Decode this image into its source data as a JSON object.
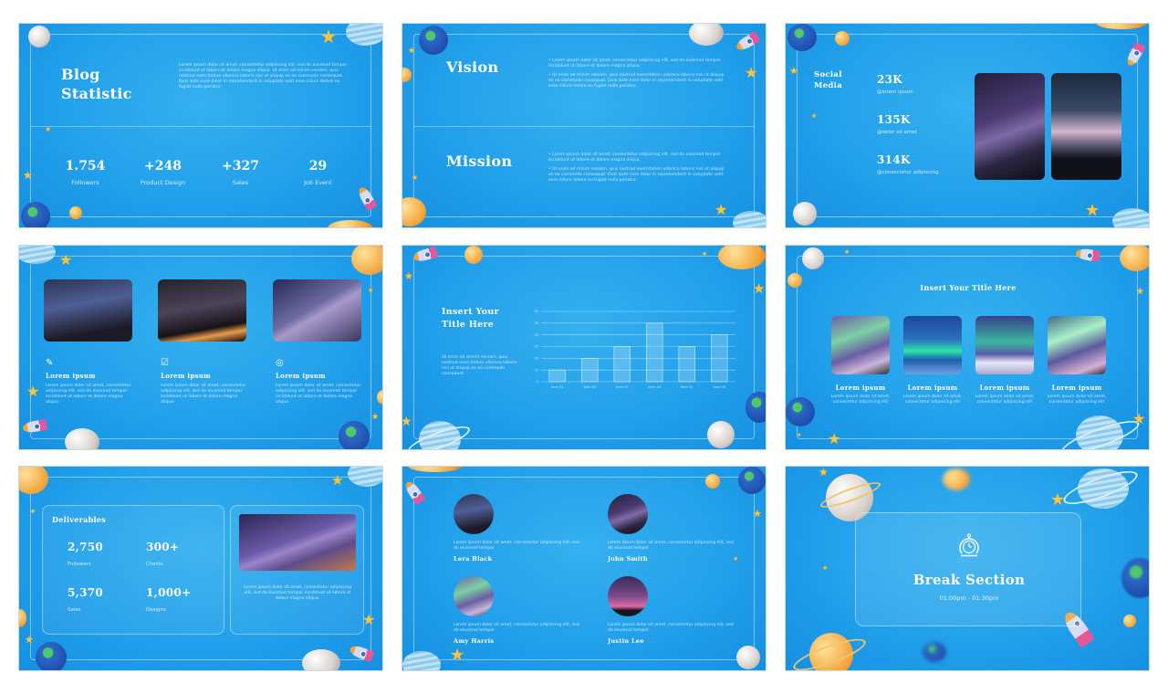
{
  "slides": [
    {
      "title": "Blog Statistic",
      "title_lines": [
        "Blog",
        "Statistic"
      ],
      "paragraph": "Lorem ipsum dolor sit amet, consectetur adipiscing elit, sed do eiusmod tempor incididunt ut labore et dolore magna aliqua. Ut enim ad minim veniam, quis nostrud exercitation ullamco laboris nisi ut aliquip ex ea commodo consequat. Duis aute irure dolor in reprehenderit in voluptate velit esse cillum dolore eu fugiat nulla pariatur.",
      "stats": [
        {
          "value": "1.754",
          "label": "Followers"
        },
        {
          "value": "+248",
          "label": "Product Design"
        },
        {
          "value": "+327",
          "label": "Sales"
        },
        {
          "value": "29",
          "label": "Job Event"
        }
      ]
    },
    {
      "sections": [
        {
          "title": "Vision",
          "bullets": [
            "Lorem ipsum dolor sit amet, consectetur adipiscing elit, sed do eiusmod tempor incididunt ut labore et dolore magna aliqua.",
            "Ut enim ad minim veniam, quis nostrud exercitation ullamco laboris nisi ut aliquip ex ea commodo consequat. Duis aute irure dolor in reprehenderit in voluptate velit esse cillum dolore eu fugiat nulla pariatur."
          ]
        },
        {
          "title": "Mission",
          "bullets": [
            "Lorem ipsum dolor sit amet, consectetur adipiscing elit, sed do eiusmod tempor incididunt ut labore et dolore magna aliqua.",
            "Ut enim ad minim veniam, quis nostrud exercitation ullamco laboris nisi ut aliquip ex ea commodo consequat. Duis aute irure dolor in reprehenderit in voluptate velit esse cillum dolore eu fugiat nulla pariatur."
          ]
        }
      ]
    },
    {
      "title_lines": [
        "Social",
        "Media"
      ],
      "stats": [
        {
          "value": "23K",
          "handle": "@lorem ipsum"
        },
        {
          "value": "135K",
          "handle": "@dolor sit amet"
        },
        {
          "value": "314K",
          "handle": "@consectetur adipiscing"
        }
      ]
    },
    {
      "columns": [
        {
          "icon": "document-edit-icon",
          "title": "Lorem ipsum",
          "text": "Lorem ipsum dolor sit amet, consectetur adipiscing elit, sed do eiusmod tempor incididunt ut labore et dolore magna aliqua."
        },
        {
          "icon": "checklist-icon",
          "title": "Lorem ipsum",
          "text": "Lorem ipsum dolor sit amet, consectetur adipiscing elit, sed do eiusmod tempor incididunt ut labore et dolore magna aliqua."
        },
        {
          "icon": "target-icon",
          "title": "Lorem ipsum",
          "text": "Lorem ipsum dolor sit amet, consectetur adipiscing elit, sed do eiusmod tempor incididunt ut labore et dolore magna aliqua."
        }
      ]
    },
    {
      "title_lines": [
        "Insert Your",
        "Title Here"
      ],
      "paragraph": "Ut enim ad minim veniam, quis nostrud exercitation ullamco laboris nisi ut aliquip ex ea commodo consequat."
    },
    {
      "title": "Insert Your Title Here",
      "cards": [
        {
          "title": "Lorem ipsum",
          "text": "Lorem ipsum dolor sit amet, consectetur adipiscing elit"
        },
        {
          "title": "Lorem ipsum",
          "text": "Lorem ipsum dolor sit amet, consectetur adipiscing elit"
        },
        {
          "title": "Lorem ipsum",
          "text": "Lorem ipsum dolor sit amet, consectetur adipiscing elit"
        },
        {
          "title": "Lorem ipsum",
          "text": "Lorem ipsum dolor sit amet, consectetur adipiscing elit"
        }
      ]
    },
    {
      "title": "Deliverables",
      "stats": [
        {
          "value": "2,750",
          "label": "Followers"
        },
        {
          "value": "300+",
          "label": "Clients"
        },
        {
          "value": "5,370",
          "label": "Sales"
        },
        {
          "value": "1,000+",
          "label": "Designs"
        }
      ],
      "caption": "Lorem ipsum dolor sit amet, consectetur adipiscing elit, sed do eiusmod tempor incididunt ut labore et dolore magna aliqua."
    },
    {
      "team": [
        {
          "name": "Lora Black",
          "text": "Lorem ipsum dolor sit amet, consectetur adipiscing elit, sed do eiusmod tempor"
        },
        {
          "name": "John Smith",
          "text": "Lorem ipsum dolor sit amet, consectetur adipiscing elit, sed do eiusmod tempor"
        },
        {
          "name": "Amy Harris",
          "text": "Lorem ipsum dolor sit amet, consectetur adipiscing elit, sed do eiusmod tempor"
        },
        {
          "name": "Justin Lee",
          "text": "Lorem ipsum dolor sit amet, consectetur adipiscing elit, sed do eiusmod tempor"
        }
      ]
    },
    {
      "icon": "stopwatch-icon",
      "title": "Break Section",
      "time": "01:00pm - 01:30pm"
    }
  ],
  "chart_data": {
    "type": "bar",
    "title": "",
    "categories": [
      "Item 01",
      "Item 02",
      "Item 03",
      "Item 04",
      "Item 05",
      "Item 06"
    ],
    "values": [
      10,
      20,
      30,
      50,
      30,
      40
    ],
    "xlabel": "",
    "ylabel": "",
    "ylim": [
      0,
      60
    ],
    "yticks": [
      0,
      10,
      20,
      30,
      40,
      50,
      60
    ],
    "grid": true,
    "legend": "none"
  },
  "colors": {
    "background": "#22a0ea",
    "text": "#ffffff",
    "accent_star": "#f7c545"
  }
}
